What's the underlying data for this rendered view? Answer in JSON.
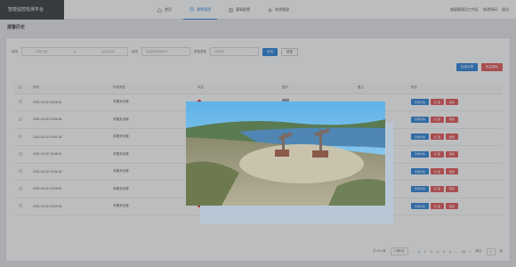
{
  "app": {
    "title": "智能监控检测平台"
  },
  "nav": [
    {
      "label": "首页",
      "icon": "home-icon",
      "active": false
    },
    {
      "label": "预警管理",
      "icon": "alarm-icon",
      "active": true
    },
    {
      "label": "基础配置",
      "icon": "config-icon",
      "active": false
    },
    {
      "label": "系统管理",
      "icon": "system-icon",
      "active": false
    }
  ],
  "user": {
    "username": "超级管理员工作区",
    "change_password": "修改密码",
    "logout": "退出"
  },
  "page": {
    "title": "报警历史"
  },
  "filter": {
    "time_label": "时间",
    "start_placeholder": "开始日期",
    "separator": "至",
    "end_placeholder": "结束日期",
    "status_label": "状态",
    "status_placeholder": "请选择处理状态",
    "type_label": "异常类型",
    "type_placeholder": "请选择",
    "search_label": "查询",
    "reset_label": "重置"
  },
  "actions": {
    "export_label": "批量处理",
    "delete_label": "批量删除"
  },
  "table": {
    "columns": [
      "时间",
      "异常类型",
      "状态",
      "图片",
      "备注",
      "操作"
    ],
    "rows": [
      {
        "time": "2021-03-02 16:26:24",
        "type": "未戴安全帽"
      },
      {
        "time": "2021-03-02 15:55:36",
        "type": "未戴安全帽"
      },
      {
        "time": "2021-03-02 15:51:18",
        "type": "未戴安全帽"
      },
      {
        "time": "2021-03-02 15:49:21",
        "type": "未戴安全帽"
      },
      {
        "time": "2021-03-02 15:31:18",
        "type": "未戴安全帽"
      },
      {
        "time": "2021-03-02 15:29:51",
        "type": "未戴安全帽"
      },
      {
        "time": "2021-03-02 15:20:05",
        "type": "未戴安全帽"
      }
    ],
    "row_actions": {
      "view": "查看详情",
      "handle": "处 理",
      "delete": "删除"
    }
  },
  "pager": {
    "total": "共 513 条",
    "page_size": "10条/页",
    "pages": [
      "1",
      "2",
      "3",
      "4",
      "5",
      "6",
      "...",
      "52"
    ],
    "current": "1",
    "goto_label": "前往",
    "goto_value": "1",
    "goto_suffix": "页"
  },
  "colors": {
    "accent": "#1e7bd6",
    "danger": "#e24b4b",
    "brand_bg": "#2b2e33"
  }
}
